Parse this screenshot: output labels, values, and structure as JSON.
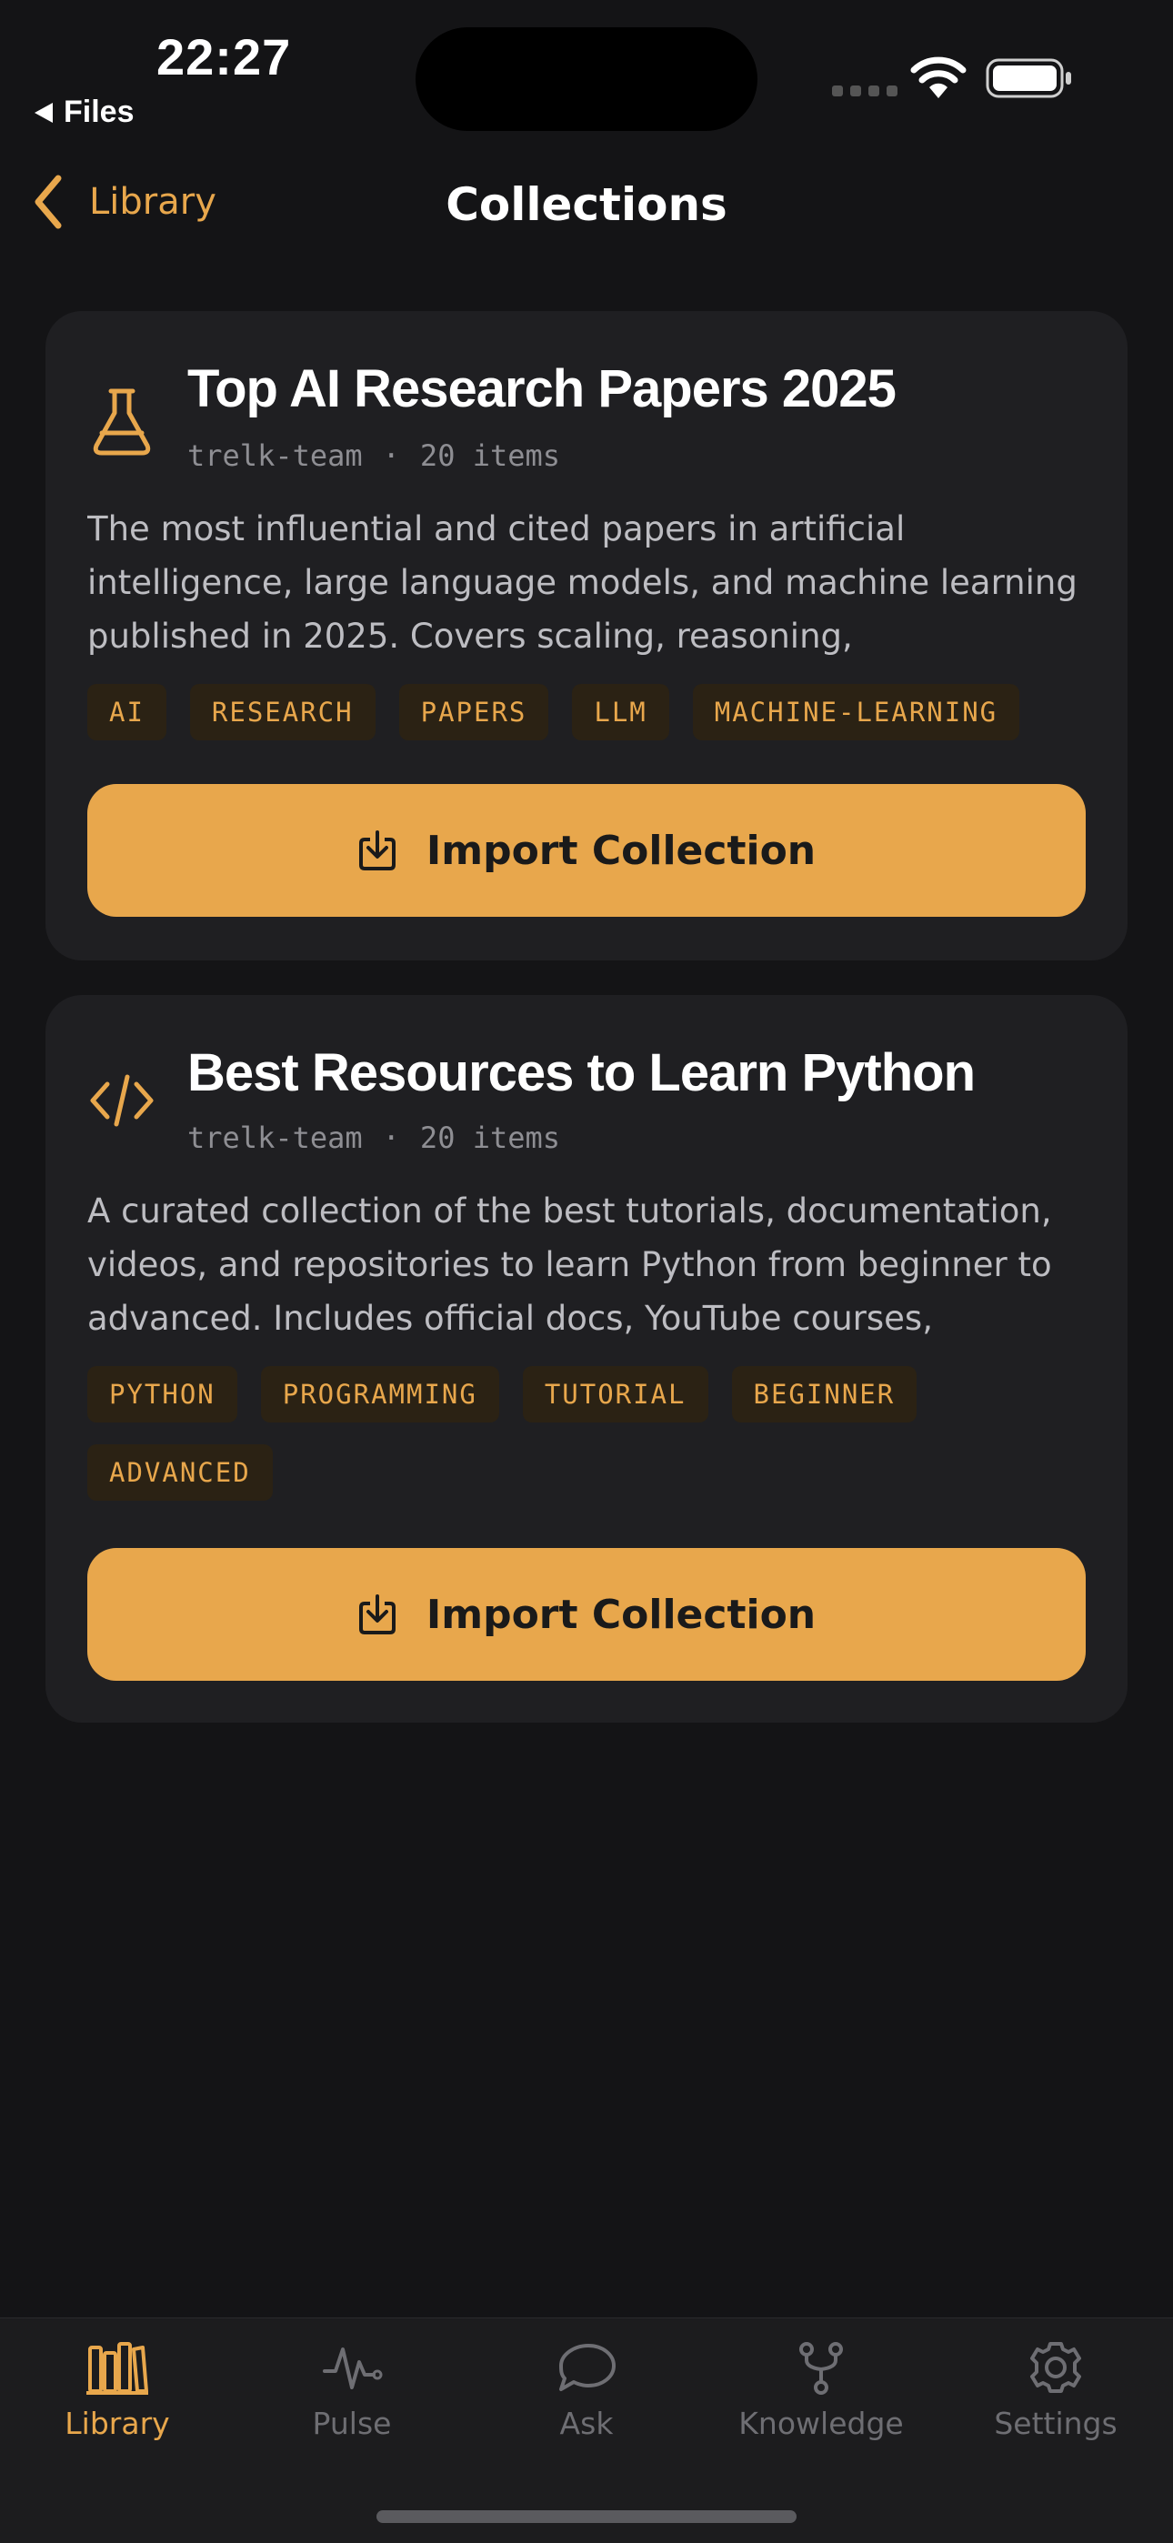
{
  "status_bar": {
    "time": "22:27",
    "back_app": "Files"
  },
  "nav": {
    "back_label": "Library",
    "title": "Collections"
  },
  "collections": [
    {
      "icon": "flask-icon",
      "title": "Top AI Research Papers 2025",
      "author": "trelk-team",
      "separator": "·",
      "count": "20 items",
      "description": "The most influential and cited papers in artificial intelligence, large language models, and machine learning published in 2025. Covers scaling, reasoning, multimodality, alignment, a…",
      "tags": [
        "AI",
        "RESEARCH",
        "PAPERS",
        "LLM",
        "MACHINE-LEARNING"
      ],
      "button_label": "Import Collection"
    },
    {
      "icon": "code-icon",
      "title": "Best Resources to Learn Python",
      "author": "trelk-team",
      "separator": "·",
      "count": "20 items",
      "description": "A curated collection of the best tutorials, documentation, videos, and repositories to learn Python from beginner to advanced. Includes official docs, YouTube courses, GitHub…",
      "tags": [
        "PYTHON",
        "PROGRAMMING",
        "TUTORIAL",
        "BEGINNER",
        "ADVANCED"
      ],
      "button_label": "Import Collection"
    }
  ],
  "tabbar": {
    "items": [
      {
        "label": "Library",
        "icon": "library-icon",
        "active": true
      },
      {
        "label": "Pulse",
        "icon": "pulse-icon",
        "active": false
      },
      {
        "label": "Ask",
        "icon": "chat-bubble-icon",
        "active": false
      },
      {
        "label": "Knowledge",
        "icon": "branch-icon",
        "active": false
      },
      {
        "label": "Settings",
        "icon": "gear-icon",
        "active": false
      }
    ]
  },
  "colors": {
    "accent": "#E8A74C",
    "background": "#141416",
    "card": "#1f1f22",
    "tag_bg": "#2b2214"
  }
}
